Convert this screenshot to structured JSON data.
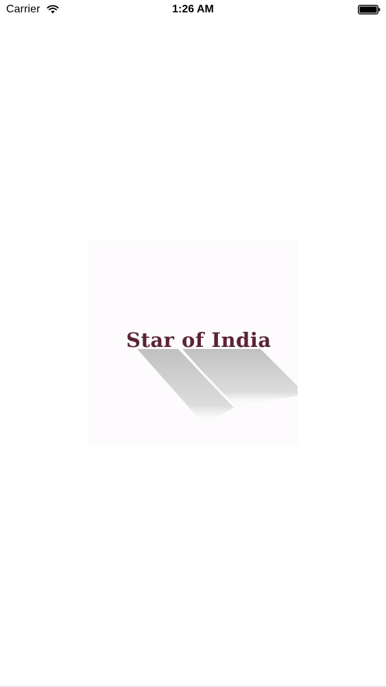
{
  "status_bar": {
    "carrier": "Carrier",
    "time": "1:26 AM",
    "wifi_icon": "wifi-icon",
    "battery_icon": "battery-icon"
  },
  "splash": {
    "brand_name": "Star of India",
    "brand_color": "#5a2433",
    "shadow_color": "#cfcfcf"
  }
}
